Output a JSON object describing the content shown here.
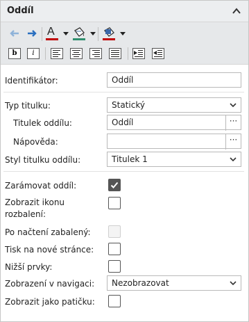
{
  "header": {
    "title": "Oddíl",
    "collapse_icon": "chevron-up-icon"
  },
  "toolbar": {
    "undo_icon": "arrow-left-icon",
    "redo_icon": "arrow-right-icon",
    "font_color_label": "A",
    "bold_label": "b",
    "italic_label": "i"
  },
  "form": {
    "identifier": {
      "label": "Identifikátor:",
      "value": "Oddíl"
    },
    "title_type": {
      "label": "Typ titulku:",
      "value": "Statický"
    },
    "section_title": {
      "label": "Titulek oddílu:",
      "value": "Oddíl",
      "button": "···"
    },
    "help": {
      "label": "Nápověda:",
      "value": "",
      "button": "···"
    },
    "title_style": {
      "label": "Styl titulku oddílu:",
      "value": "Titulek 1"
    },
    "frame_section": {
      "label": "Zarámovat oddíl:",
      "checked": true
    },
    "show_expand_icon": {
      "label_line1": "Zobrazit ikonu",
      "label_line2": "rozbalení:",
      "checked": false
    },
    "collapsed_on_load": {
      "label": "Po načtení zabalený:",
      "checked": false,
      "disabled": true
    },
    "print_new_page": {
      "label": "Tisk na nové stránce:",
      "checked": false
    },
    "lower_items": {
      "label": "Nižší prvky:",
      "checked": false
    },
    "nav_display": {
      "label": "Zobrazení v navigaci:",
      "value": "Nezobrazovat"
    },
    "show_as_footer": {
      "label": "Zobrazit jako patičku:",
      "checked": false
    }
  },
  "colors": {
    "header_bg": "#eceef0",
    "toolbar_bg": "#e6e8ea",
    "font_color_underline": "#c00000",
    "fill_color_underline": "#2f8f6f",
    "border_color_underline": "#c00000"
  }
}
